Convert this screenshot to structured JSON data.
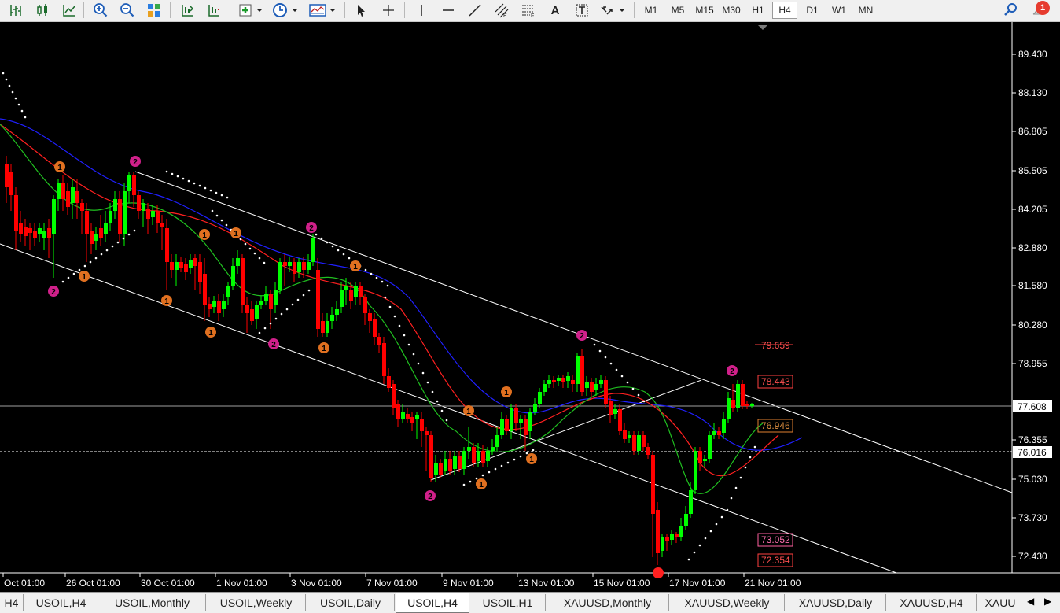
{
  "toolbar": {
    "timeframes": [
      "M1",
      "M5",
      "M15",
      "M30",
      "H1",
      "H4",
      "D1",
      "W1",
      "MN"
    ],
    "active_timeframe": "H4",
    "text_tool": "A",
    "notification_count": "1",
    "colors": {
      "bg": "#f0f0f0",
      "bull": "#00ff00",
      "bear": "#ff0000"
    }
  },
  "chart": {
    "price_axis": [
      "89.430",
      "88.130",
      "86.805",
      "85.505",
      "84.205",
      "82.880",
      "81.580",
      "80.280",
      "78.955",
      "77.608",
      "76.355",
      "76.016",
      "75.030",
      "73.730",
      "72.430"
    ],
    "current_price": "77.608",
    "dotted_level": "76.016",
    "time_axis": [
      "Oct 01:00",
      "26 Oct 01:00",
      "30 Oct 01:00",
      "1 Nov 01:00",
      "3 Nov 01:00",
      "7 Nov 01:00",
      "9 Nov 01:00",
      "13 Nov 01:00",
      "15 Nov 01:00",
      "17 Nov 01:00",
      "21 Nov 01:00"
    ],
    "fib_labels": [
      "79.659",
      "78.443",
      "76.946",
      "73.052",
      "72.354"
    ],
    "wave_labels": [
      "1",
      "2"
    ]
  },
  "tabs": {
    "items": [
      "H4",
      "USOIL,H4",
      "USOIL,Monthly",
      "USOIL,Weekly",
      "USOIL,Daily",
      "USOIL,H4",
      "USOIL,H1",
      "XAUUSD,Monthly",
      "XAUUSD,Weekly",
      "XAUUSD,Daily",
      "XAUUSD,H4",
      "XAUU"
    ],
    "active_index": 5
  }
}
